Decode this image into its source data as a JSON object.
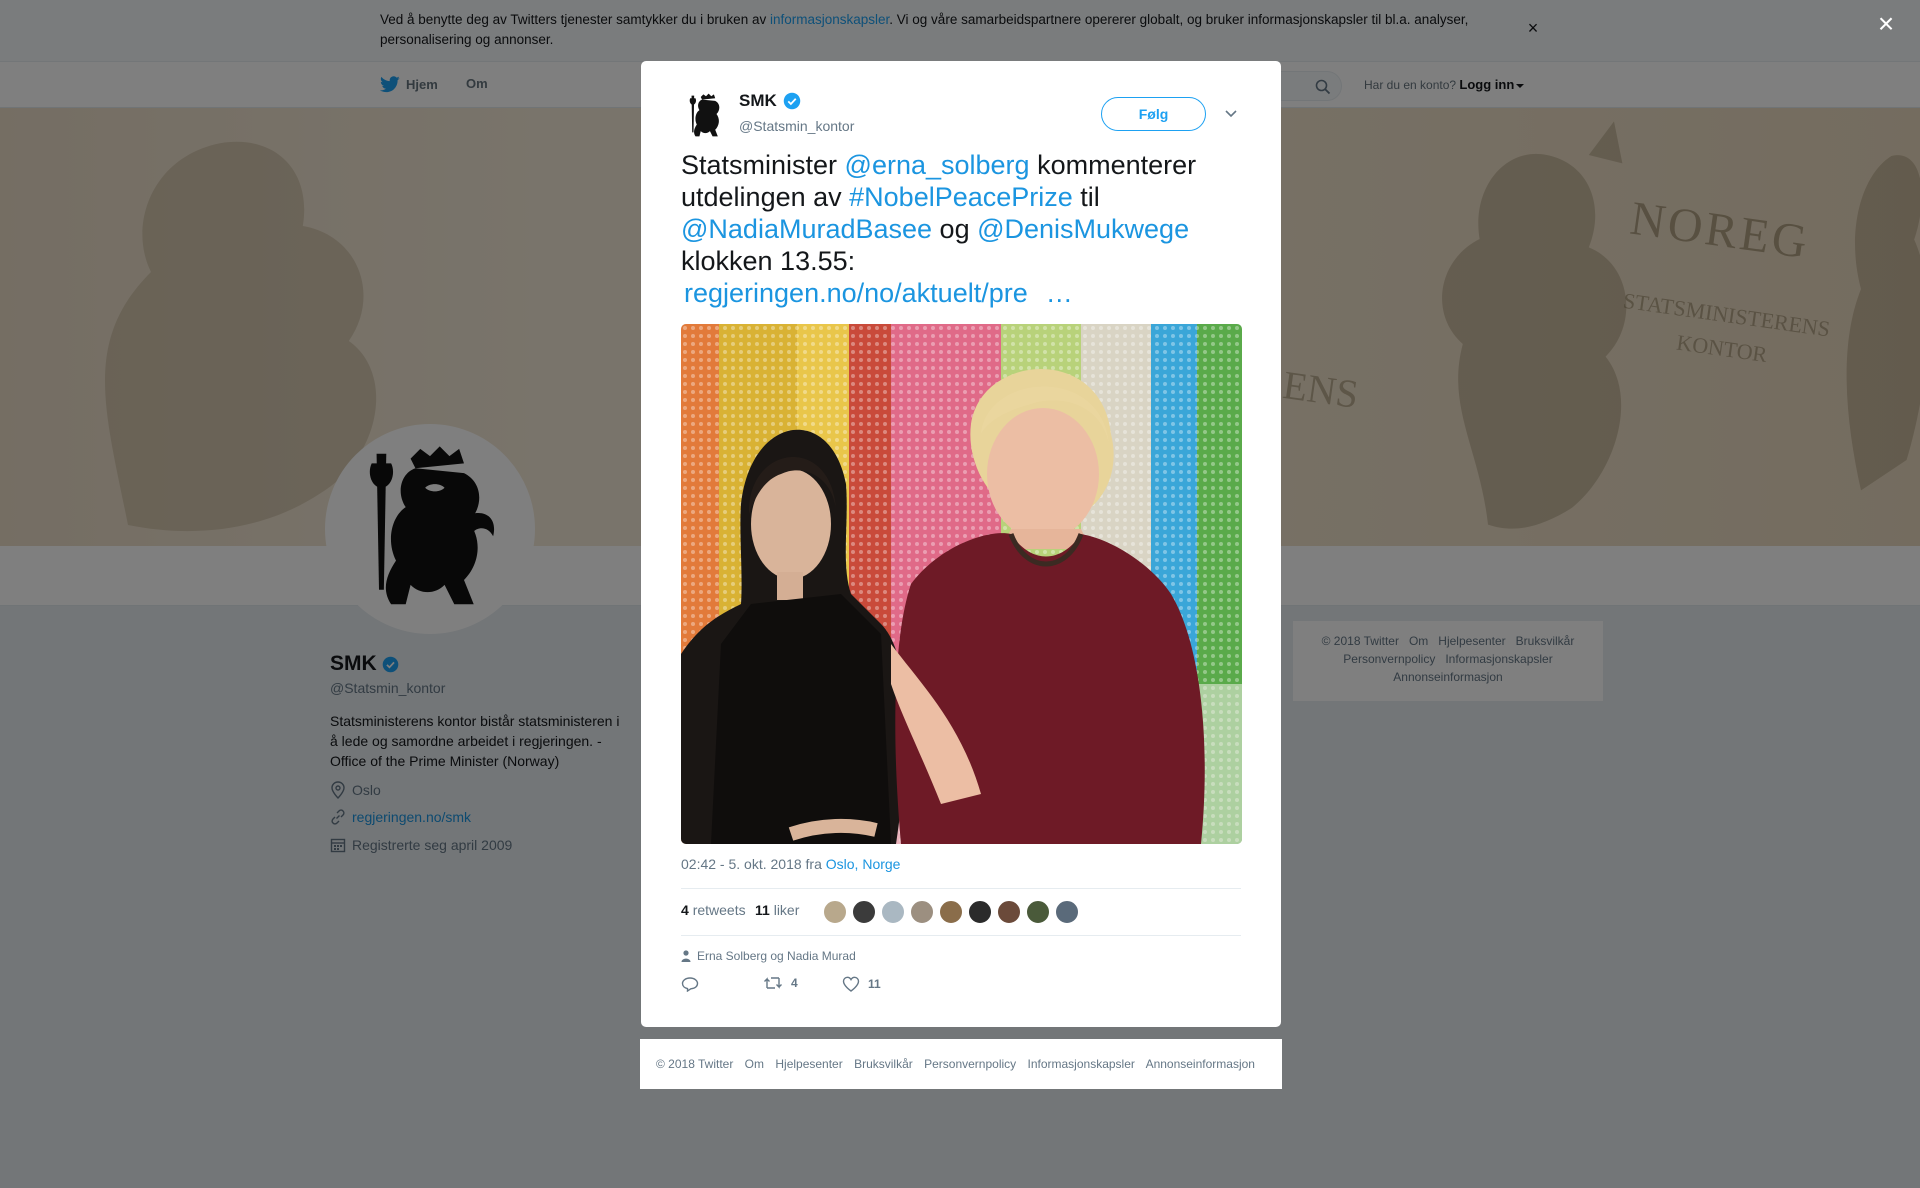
{
  "cookie_bar": {
    "text_before": "Ved å benytte deg av Twitters tjenester samtykker du i bruken av ",
    "link": "informasjonskapsler",
    "text_after": ". Vi og våre samarbeidspartnere opererer globalt, og bruker informasjonskapsler til bl.a. analyser, personalisering og annonser.",
    "close": "×"
  },
  "nav": {
    "home": "Hjem",
    "about": "Om",
    "account_prompt": "Har du en konto?",
    "login": "Logg inn"
  },
  "banner": {
    "noreg": "NOREG",
    "statsministerens": "STATSMINISTERENS",
    "kontor": "KONTOR",
    "ens": "ENS"
  },
  "profile": {
    "name": "SMK",
    "handle": "@Statsmin_kontor",
    "bio": "Statsministerens kontor bistår statsministeren i å lede og samordne arbeidet i regjeringen. - Office of the Prime Minister (Norway)",
    "location": "Oslo",
    "website": "regjeringen.no/smk",
    "joined": "Registrerte seg april 2009"
  },
  "side_footer": {
    "items": [
      "© 2018 Twitter",
      "Om",
      "Hjelpesenter",
      "Bruksvilkår",
      "Personvernpolicy",
      "Informasjonskapsler",
      "Annonseinformasjon"
    ]
  },
  "overlay": {
    "close": "×"
  },
  "tweet": {
    "author_name": "SMK",
    "author_handle": "@Statsmin_kontor",
    "follow_label": "Følg",
    "text_parts": {
      "p1": "Statsminister ",
      "mention1": "@erna_solberg",
      "p2": " kommenterer utdelingen av ",
      "hashtag": "#NobelPeacePrize",
      "p3": " til ",
      "mention2": "@NadiaMuradBasee",
      "p4": " og ",
      "mention3": "@DenisMukwege",
      "p5": " klokken 13.55: ",
      "url": "regjeringen.no/no/aktuelt/pre",
      "ellipsis": "…"
    },
    "time": "02:42 - 5. okt. 2018 fra ",
    "location": "Oslo, Norge",
    "retweets_count": "4",
    "retweets_label": "retweets",
    "likes_count": "11",
    "likes_label": "liker",
    "tagged": "Erna Solberg og Nadia Murad",
    "action_retweets": "4",
    "action_likes": "11"
  },
  "likers_colors": [
    "#b8a88c",
    "#3b3b3b",
    "#aab8c2",
    "#9c8f80",
    "#8a6d4a",
    "#2b2b2b",
    "#6b4a3a",
    "#4a5a3a",
    "#5a6a7a"
  ],
  "modal_footer": {
    "items": [
      "© 2018 Twitter",
      "Om",
      "Hjelpesenter",
      "Bruksvilkår",
      "Personvernpolicy",
      "Informasjonskapsler",
      "Annonseinformasjon"
    ]
  },
  "colors": {
    "accent": "#1da1f2",
    "link": "#1b95e0",
    "verified": "#1da1f2"
  }
}
